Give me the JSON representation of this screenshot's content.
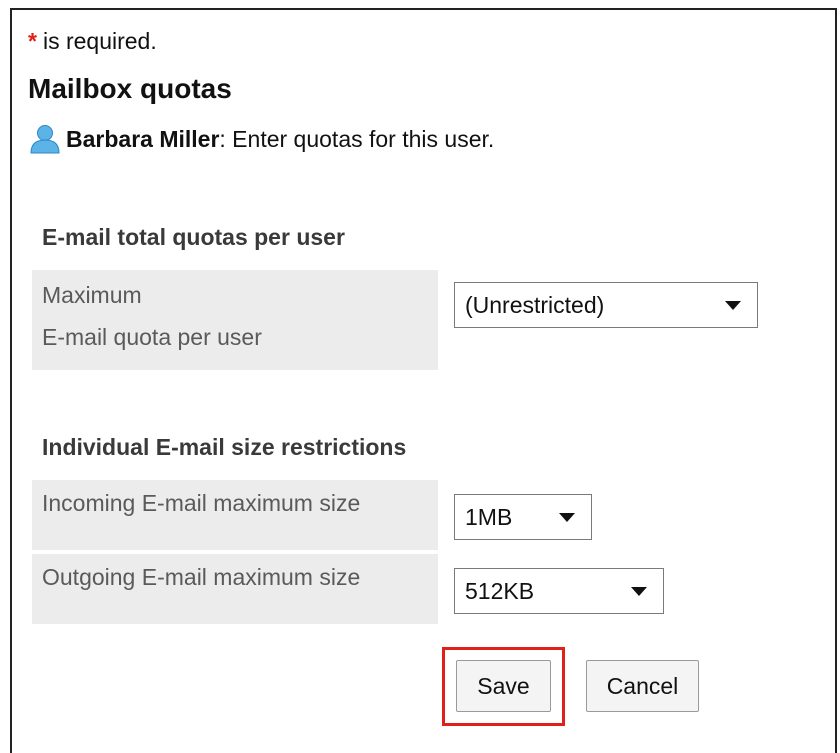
{
  "required_note": {
    "star": "*",
    "text": "is required."
  },
  "page_title": "Mailbox quotas",
  "user": {
    "icon": "user-icon",
    "name": "Barbara Miller",
    "instruction": ": Enter quotas for this user."
  },
  "total_quota_section": {
    "heading": "E-mail total quotas per user",
    "rows": [
      {
        "label_line1": "Maximum",
        "label_line2": "E-mail quota per user",
        "selected": "(Unrestricted)"
      }
    ]
  },
  "size_section": {
    "heading": "Individual E-mail size restrictions",
    "rows": [
      {
        "label": "Incoming E-mail maximum size",
        "selected": "1MB"
      },
      {
        "label": "Outgoing E-mail maximum size",
        "selected": "512KB"
      }
    ]
  },
  "buttons": {
    "save": "Save",
    "cancel": "Cancel"
  },
  "colors": {
    "required_star": "#e0201a",
    "highlight": "#e0201a",
    "label_background": "#ececec",
    "user_icon": "#4aa3df"
  }
}
